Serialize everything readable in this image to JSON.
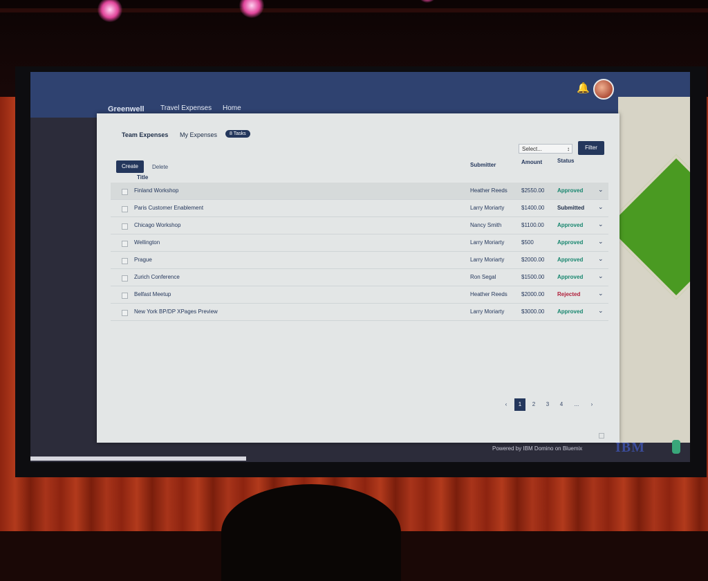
{
  "app": {
    "brand": "Greenwell",
    "nav": [
      "Travel Expenses",
      "Home"
    ]
  },
  "subnav": {
    "team_tab": "Team Expenses",
    "my_tab": "My Expenses",
    "badge": "8 Tasks"
  },
  "toolbar": {
    "select_value": "Select...",
    "filter_label": "Filter",
    "create_label": "Create",
    "delete_label": "Delete"
  },
  "table": {
    "headers": [
      "Title",
      "Submitter",
      "Amount",
      "Status"
    ],
    "rows": [
      {
        "title": "Finland Workshop",
        "submitter": "Heather Reeds",
        "amount": "$2550.00",
        "status": "Approved"
      },
      {
        "title": "Paris Customer Enablement",
        "submitter": "Larry Moriarty",
        "amount": "$1400.00",
        "status": "Submitted"
      },
      {
        "title": "Chicago Workshop",
        "submitter": "Nancy Smith",
        "amount": "$1100.00",
        "status": "Approved"
      },
      {
        "title": "Wellington",
        "submitter": "Larry Moriarty",
        "amount": "$500",
        "status": "Approved"
      },
      {
        "title": "Prague",
        "submitter": "Larry Moriarty",
        "amount": "$2000.00",
        "status": "Approved"
      },
      {
        "title": "Zurich Conference",
        "submitter": "Ron Segal",
        "amount": "$1500.00",
        "status": "Approved"
      },
      {
        "title": "Belfast Meetup",
        "submitter": "Heather Reeds",
        "amount": "$2000.00",
        "status": "Rejected"
      },
      {
        "title": "New York BP/DP XPages Preview",
        "submitter": "Larry Moriarty",
        "amount": "$3000.00",
        "status": "Approved"
      }
    ]
  },
  "pagination": {
    "prev": "‹",
    "pages": [
      "1",
      "2",
      "3",
      "4",
      "..."
    ],
    "next": "›",
    "current": "1"
  },
  "footer": {
    "powered_by": "Powered by IBM Domino on Bluemix",
    "logo": "IBM"
  },
  "colors": {
    "nav_bg": "#2f4270",
    "primary": "#24375c",
    "approved": "#17866e",
    "rejected": "#b01e3a"
  }
}
